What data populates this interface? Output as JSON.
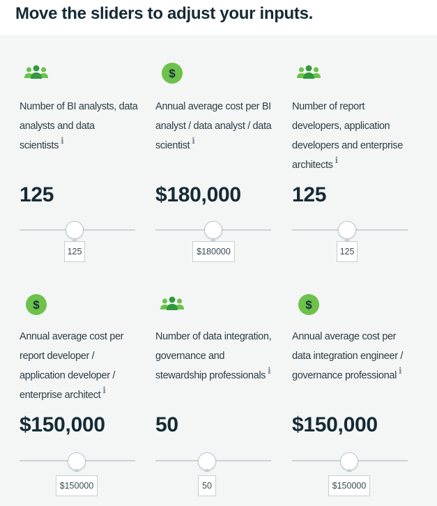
{
  "heading": "Move the sliders to adjust your inputs.",
  "colors": {
    "accent_green": "#6cc24a",
    "text_dark": "#152a33"
  },
  "cards": [
    {
      "icon": "people-icon",
      "label": "Number of BI analysts, data analysts and data scientists",
      "info": "i",
      "value_display": "125",
      "input_value": "125",
      "slider_fraction": 0.48
    },
    {
      "icon": "dollar-icon",
      "label": "Annual average cost per BI analyst / data analyst / data scientist",
      "info": "i",
      "value_display": "$180,000",
      "input_value": "$180000",
      "slider_fraction": 0.5
    },
    {
      "icon": "people-icon",
      "label": "Number of report developers, application developers and enterprise architects",
      "info": "i",
      "value_display": "125",
      "input_value": "125",
      "slider_fraction": 0.48
    },
    {
      "icon": "dollar-icon",
      "label": "Annual average cost per report developer / application developer / enterprise architect",
      "info": "i",
      "value_display": "$150,000",
      "input_value": "$150000",
      "slider_fraction": 0.5
    },
    {
      "icon": "people-icon",
      "label": "Number of data integration, governance and stewardship professionals",
      "info": "i",
      "value_display": "50",
      "input_value": "50",
      "slider_fraction": 0.42
    },
    {
      "icon": "dollar-icon",
      "label": "Annual average cost per data integration engineer / governance professional",
      "info": "i",
      "value_display": "$150,000",
      "input_value": "$150000",
      "slider_fraction": 0.5
    }
  ]
}
